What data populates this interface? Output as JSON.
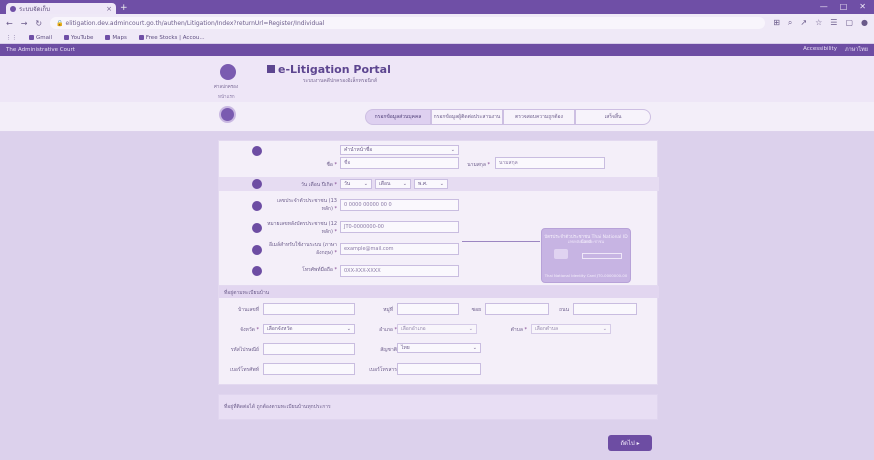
{
  "browser": {
    "tab_title": "ระบบจัดเก็บ",
    "url": "elitigation.dev.admincourt.go.th/authen/Litigation/Index?returnUrl=Register/Individual",
    "bookmarks": [
      "Gmail",
      "YouTube",
      "Maps",
      "Free Stocks | Accou..."
    ],
    "controls": [
      "—",
      "□",
      "✕"
    ]
  },
  "sitebar": {
    "left": "The Administrative Court",
    "right": [
      "Accessibility",
      "ภาษาไทย"
    ]
  },
  "header": {
    "logo_caption": "ศาลปกครอง",
    "title": "e-Litigation Portal",
    "subtitle": "ระบบงานคดีปกครองอิเล็กทรอนิกส์",
    "breadcrumb": "หน้าแรก"
  },
  "steps": [
    {
      "label": "กรอกข้อมูลส่วนบุคคล",
      "active": true
    },
    {
      "label": "กรอกข้อมูลผู้ติดต่อประสานงาน",
      "active": false
    },
    {
      "label": "ตรวจสอบความถูกต้อง",
      "active": false
    },
    {
      "label": "เสร็จสิ้น",
      "active": false
    }
  ],
  "form": {
    "prefix_select": "คำนำหน้าชื่อ",
    "firstname_label": "ชื่อ",
    "firstname_placeholder": "ชื่อ",
    "lastname_label": "นามสกุล",
    "lastname_placeholder": "นามสกุล",
    "birth_label": "วัน เดือน ปีเกิด",
    "birth_day": "วัน",
    "birth_month": "เดือน",
    "birth_year": "พ.ศ.",
    "id_label": "เลขประจำตัวประชาชน (13 หลัก)",
    "id_placeholder": "0 0000 00000 00 0",
    "laser_label": "หมายเลขหลังบัตรประชาชน (12 หลัก)",
    "laser_placeholder": "JT0-0000000-00",
    "email_label": "อีเมล์สำหรับใช้งานระบบ (ภาษาอังกฤษ)",
    "email_placeholder": "example@mail.com",
    "phone_label": "โทรศัพท์มือถือ",
    "phone_placeholder": "0XX-XXX-XXXX"
  },
  "idcard": {
    "title": "บัตรประจำตัวประชาชน Thai National ID Card",
    "subtitle": "เลขหลังบัตรประชาชน",
    "footer": "Thai National Identity Card  JT0-0000000-00"
  },
  "address": {
    "section_title": "ที่อยู่ตามทะเบียนบ้าน",
    "house_no": "บ้านเลขที่",
    "moo": "หมู่ที่",
    "soi": "ซอย",
    "road": "ถนน",
    "province": "จังหวัด",
    "province_select": "เลือกจังหวัด",
    "district": "อำเภอ",
    "district_select": "เลือกอำเภอ",
    "subdistrict": "ตำบล",
    "subdistrict_select": "เลือกตำบล",
    "postal": "รหัสไปรษณีย์",
    "nationality": "สัญชาติ",
    "nationality_select": "ไทย",
    "fax": "เบอร์โทรศัพท์",
    "other": "เบอร์โทรสาร"
  },
  "contact_note": "ที่อยู่ที่ติดต่อได้  ถูกต้องตามทะเบียนบ้านทุกประการ",
  "next_button": "ถัดไป ▸"
}
